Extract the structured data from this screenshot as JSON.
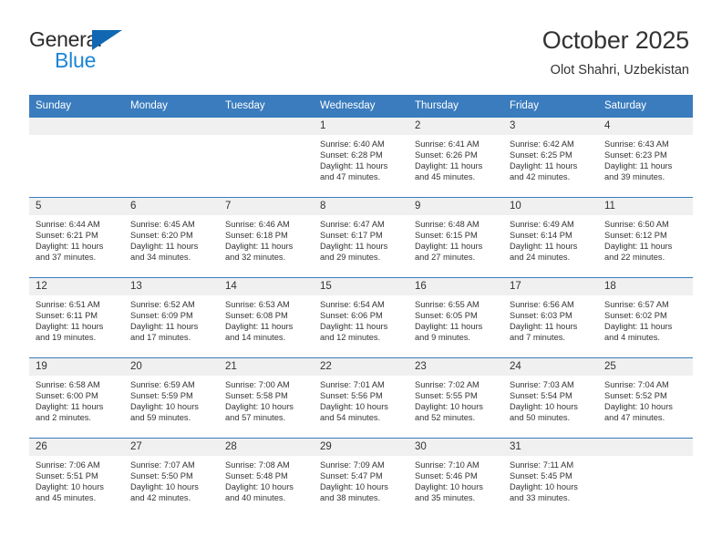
{
  "brand": {
    "line1": "General",
    "line2": "Blue",
    "triangle_color": "#1167b1",
    "text_color": "#2b2b2b",
    "blue_text_color": "#1b85d6"
  },
  "header": {
    "title": "October 2025",
    "subtitle": "Olot Shahri, Uzbekistan"
  },
  "theme": {
    "header_bg": "#3a7cbe",
    "header_text": "#ffffff",
    "daynum_bg": "#f0f0f0",
    "body_text": "#333333"
  },
  "weekdays": [
    "Sunday",
    "Monday",
    "Tuesday",
    "Wednesday",
    "Thursday",
    "Friday",
    "Saturday"
  ],
  "labels": {
    "sunrise": "Sunrise:",
    "sunset": "Sunset:",
    "daylight": "Daylight:"
  },
  "weeks": [
    [
      {
        "day": "",
        "empty": true
      },
      {
        "day": "",
        "empty": true
      },
      {
        "day": "",
        "empty": true
      },
      {
        "day": "1",
        "sunrise": "Sunrise: 6:40 AM",
        "sunset": "Sunset: 6:28 PM",
        "daylight": "Daylight: 11 hours and 47 minutes."
      },
      {
        "day": "2",
        "sunrise": "Sunrise: 6:41 AM",
        "sunset": "Sunset: 6:26 PM",
        "daylight": "Daylight: 11 hours and 45 minutes."
      },
      {
        "day": "3",
        "sunrise": "Sunrise: 6:42 AM",
        "sunset": "Sunset: 6:25 PM",
        "daylight": "Daylight: 11 hours and 42 minutes."
      },
      {
        "day": "4",
        "sunrise": "Sunrise: 6:43 AM",
        "sunset": "Sunset: 6:23 PM",
        "daylight": "Daylight: 11 hours and 39 minutes."
      }
    ],
    [
      {
        "day": "5",
        "sunrise": "Sunrise: 6:44 AM",
        "sunset": "Sunset: 6:21 PM",
        "daylight": "Daylight: 11 hours and 37 minutes."
      },
      {
        "day": "6",
        "sunrise": "Sunrise: 6:45 AM",
        "sunset": "Sunset: 6:20 PM",
        "daylight": "Daylight: 11 hours and 34 minutes."
      },
      {
        "day": "7",
        "sunrise": "Sunrise: 6:46 AM",
        "sunset": "Sunset: 6:18 PM",
        "daylight": "Daylight: 11 hours and 32 minutes."
      },
      {
        "day": "8",
        "sunrise": "Sunrise: 6:47 AM",
        "sunset": "Sunset: 6:17 PM",
        "daylight": "Daylight: 11 hours and 29 minutes."
      },
      {
        "day": "9",
        "sunrise": "Sunrise: 6:48 AM",
        "sunset": "Sunset: 6:15 PM",
        "daylight": "Daylight: 11 hours and 27 minutes."
      },
      {
        "day": "10",
        "sunrise": "Sunrise: 6:49 AM",
        "sunset": "Sunset: 6:14 PM",
        "daylight": "Daylight: 11 hours and 24 minutes."
      },
      {
        "day": "11",
        "sunrise": "Sunrise: 6:50 AM",
        "sunset": "Sunset: 6:12 PM",
        "daylight": "Daylight: 11 hours and 22 minutes."
      }
    ],
    [
      {
        "day": "12",
        "sunrise": "Sunrise: 6:51 AM",
        "sunset": "Sunset: 6:11 PM",
        "daylight": "Daylight: 11 hours and 19 minutes."
      },
      {
        "day": "13",
        "sunrise": "Sunrise: 6:52 AM",
        "sunset": "Sunset: 6:09 PM",
        "daylight": "Daylight: 11 hours and 17 minutes."
      },
      {
        "day": "14",
        "sunrise": "Sunrise: 6:53 AM",
        "sunset": "Sunset: 6:08 PM",
        "daylight": "Daylight: 11 hours and 14 minutes."
      },
      {
        "day": "15",
        "sunrise": "Sunrise: 6:54 AM",
        "sunset": "Sunset: 6:06 PM",
        "daylight": "Daylight: 11 hours and 12 minutes."
      },
      {
        "day": "16",
        "sunrise": "Sunrise: 6:55 AM",
        "sunset": "Sunset: 6:05 PM",
        "daylight": "Daylight: 11 hours and 9 minutes."
      },
      {
        "day": "17",
        "sunrise": "Sunrise: 6:56 AM",
        "sunset": "Sunset: 6:03 PM",
        "daylight": "Daylight: 11 hours and 7 minutes."
      },
      {
        "day": "18",
        "sunrise": "Sunrise: 6:57 AM",
        "sunset": "Sunset: 6:02 PM",
        "daylight": "Daylight: 11 hours and 4 minutes."
      }
    ],
    [
      {
        "day": "19",
        "sunrise": "Sunrise: 6:58 AM",
        "sunset": "Sunset: 6:00 PM",
        "daylight": "Daylight: 11 hours and 2 minutes."
      },
      {
        "day": "20",
        "sunrise": "Sunrise: 6:59 AM",
        "sunset": "Sunset: 5:59 PM",
        "daylight": "Daylight: 10 hours and 59 minutes."
      },
      {
        "day": "21",
        "sunrise": "Sunrise: 7:00 AM",
        "sunset": "Sunset: 5:58 PM",
        "daylight": "Daylight: 10 hours and 57 minutes."
      },
      {
        "day": "22",
        "sunrise": "Sunrise: 7:01 AM",
        "sunset": "Sunset: 5:56 PM",
        "daylight": "Daylight: 10 hours and 54 minutes."
      },
      {
        "day": "23",
        "sunrise": "Sunrise: 7:02 AM",
        "sunset": "Sunset: 5:55 PM",
        "daylight": "Daylight: 10 hours and 52 minutes."
      },
      {
        "day": "24",
        "sunrise": "Sunrise: 7:03 AM",
        "sunset": "Sunset: 5:54 PM",
        "daylight": "Daylight: 10 hours and 50 minutes."
      },
      {
        "day": "25",
        "sunrise": "Sunrise: 7:04 AM",
        "sunset": "Sunset: 5:52 PM",
        "daylight": "Daylight: 10 hours and 47 minutes."
      }
    ],
    [
      {
        "day": "26",
        "sunrise": "Sunrise: 7:06 AM",
        "sunset": "Sunset: 5:51 PM",
        "daylight": "Daylight: 10 hours and 45 minutes."
      },
      {
        "day": "27",
        "sunrise": "Sunrise: 7:07 AM",
        "sunset": "Sunset: 5:50 PM",
        "daylight": "Daylight: 10 hours and 42 minutes."
      },
      {
        "day": "28",
        "sunrise": "Sunrise: 7:08 AM",
        "sunset": "Sunset: 5:48 PM",
        "daylight": "Daylight: 10 hours and 40 minutes."
      },
      {
        "day": "29",
        "sunrise": "Sunrise: 7:09 AM",
        "sunset": "Sunset: 5:47 PM",
        "daylight": "Daylight: 10 hours and 38 minutes."
      },
      {
        "day": "30",
        "sunrise": "Sunrise: 7:10 AM",
        "sunset": "Sunset: 5:46 PM",
        "daylight": "Daylight: 10 hours and 35 minutes."
      },
      {
        "day": "31",
        "sunrise": "Sunrise: 7:11 AM",
        "sunset": "Sunset: 5:45 PM",
        "daylight": "Daylight: 10 hours and 33 minutes."
      },
      {
        "day": "",
        "empty": true
      }
    ]
  ]
}
